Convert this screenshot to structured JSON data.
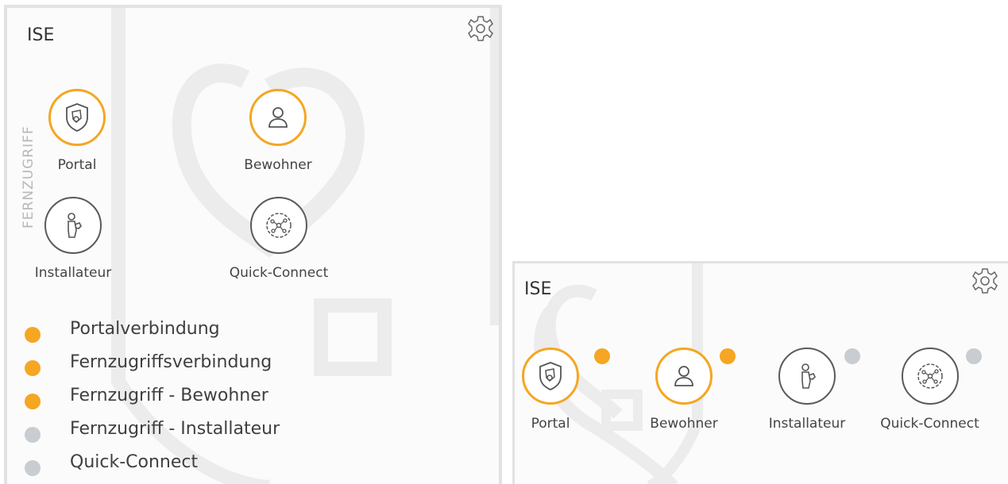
{
  "colors": {
    "accent": "#f5a623",
    "inactive": "#c9ccd1",
    "border": "#e2e2e2"
  },
  "large_panel": {
    "title": "ISE",
    "settings_icon": "gear-icon",
    "side_label": "FERNZUGRIFF",
    "tiles": [
      {
        "label": "Portal",
        "icon": "shield-icon",
        "active": true
      },
      {
        "label": "Bewohner",
        "icon": "person-icon",
        "active": true
      },
      {
        "label": "Installateur",
        "icon": "installer-icon",
        "active": false
      },
      {
        "label": "Quick-Connect",
        "icon": "network-icon",
        "active": false
      }
    ],
    "legend": [
      {
        "label": "Portalverbindung",
        "status": "active"
      },
      {
        "label": "Fernzugriffsverbindung",
        "status": "active"
      },
      {
        "label": "Fernzugriff - Bewohner",
        "status": "active"
      },
      {
        "label": "Fernzugriff - Installateur",
        "status": "inactive"
      },
      {
        "label": "Quick-Connect",
        "status": "inactive"
      }
    ]
  },
  "small_panel": {
    "title": "ISE",
    "settings_icon": "gear-icon",
    "tiles": [
      {
        "label": "Portal",
        "icon": "shield-icon",
        "active": true
      },
      {
        "label": "Bewohner",
        "icon": "person-icon",
        "active": true
      },
      {
        "label": "Installateur",
        "icon": "installer-icon",
        "active": false
      },
      {
        "label": "Quick-Connect",
        "icon": "network-icon",
        "active": false
      }
    ]
  }
}
